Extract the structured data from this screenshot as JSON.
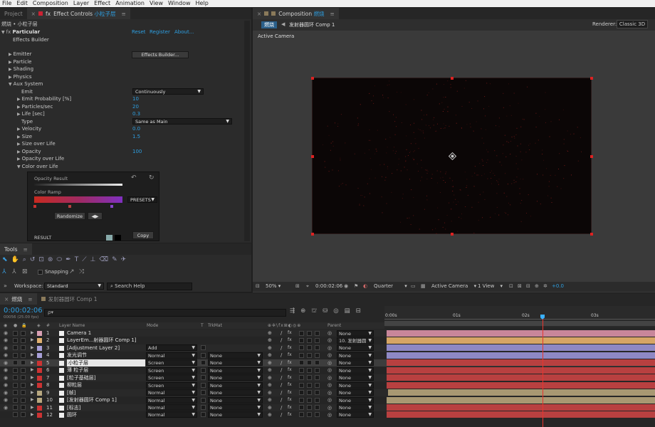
{
  "menubar": [
    "File",
    "Edit",
    "Layer",
    "Effect",
    "Animation",
    "View",
    "Window",
    "Help",
    "Composition"
  ],
  "menu": {
    "file": "File",
    "edit": "Edit",
    "composition": "Composition",
    "layer": "Layer",
    "effect": "Effect",
    "animation": "Animation",
    "view": "View",
    "window": "Window",
    "help": "Help"
  },
  "project_tab": "Project",
  "effect_controls": {
    "tab_label": "Effect Controls",
    "tab_layer": "小粒子层",
    "breadcrumb": "燃烧 • 小粒子层",
    "effect_name": "Particular",
    "reset": "Reset",
    "register": "Register",
    "about": "About...",
    "effects_builder_label": "Effects Builder",
    "effects_builder_button": "Effects Builder...",
    "emitter": "Emitter",
    "particle": "Particle",
    "shading": "Shading",
    "physics": "Physics",
    "aux_system": "Aux System",
    "emit": "Emit",
    "emit_value": "Continuously",
    "emit_probability": "Emit Probability [%]",
    "emit_probability_value": "10",
    "particles_sec": "Particles/sec",
    "particles_sec_value": "20",
    "life_sec": "Life [sec]",
    "life_sec_value": "0.3",
    "type": "Type",
    "type_value": "Same as Main",
    "velocity": "Velocity",
    "velocity_value": "0.0",
    "size": "Size",
    "size_value": "1.5",
    "size_over_life": "Size over Life",
    "opacity": "Opacity",
    "opacity_value": "100",
    "opacity_over_life": "Opacity over Life",
    "color_over_life": "Color over Life",
    "popup": {
      "opacity_result": "Opacity Result",
      "color_ramp": "Color Ramp",
      "presets": "PRESETS",
      "randomize": "Randomize",
      "result": "RESULT",
      "copy": "Copy"
    }
  },
  "tools": {
    "title": "Tools",
    "snapping": "Snapping",
    "workspace_label": "Workspace:",
    "workspace_value": "Standard",
    "search_help": "Search Help"
  },
  "composition": {
    "tab_label": "Composition",
    "tab_name": "燃烧",
    "crumb_active": "燃烧",
    "crumb_next": "发射器圆环 Comp 1",
    "renderer_label": "Renderer:",
    "renderer_value": "Classic 3D",
    "active_camera": "Active Camera",
    "zoom": "50%",
    "timecode": "0:00:02:06",
    "resolution": "Quarter",
    "view": "Active Camera",
    "views": "1 View",
    "exposure": "+0.0"
  },
  "timeline": {
    "tab_active": "燃烧",
    "tab_other": "发射器圆环 Comp 1",
    "timecode": "0:00:02:06",
    "frame_info": "00056 (25.00 fps)",
    "search_placeholder": "ρ▾",
    "col_num": "#",
    "col_layer_name": "Layer Name",
    "col_mode": "Mode",
    "col_t": "T",
    "col_trkmat": "TrkMat",
    "col_parent": "Parent",
    "ruler": [
      "0:00s",
      "01s",
      "02s",
      "03s"
    ],
    "layers": [
      {
        "num": "1",
        "name": "Camera 1",
        "mode": "",
        "trk": "",
        "parent": "None",
        "label_color": "#d9a0b4",
        "bar_color": "#c8869a"
      },
      {
        "num": "2",
        "name": "LayerEm...射器圆环 Comp 1]",
        "mode": "",
        "trk": "",
        "parent": "10. 发射器圆",
        "label_color": "#e0b070",
        "bar_color": "#d6a565"
      },
      {
        "num": "3",
        "name": "[Adjustment Layer 2]",
        "mode": "Add",
        "trk": "",
        "parent": "None",
        "label_color": "#a8a0d8",
        "bar_color": "#8e88c4"
      },
      {
        "num": "4",
        "name": "发光调节",
        "mode": "Normal",
        "trk": "None",
        "parent": "None",
        "label_color": "#a8a0d8",
        "bar_color": "#8e88c4"
      },
      {
        "num": "5",
        "name": "小粒子层",
        "mode": "Screen",
        "trk": "None",
        "parent": "None",
        "label_color": "#cc3333",
        "bar_color": "#b84040"
      },
      {
        "num": "6",
        "name": "薄 粒子层",
        "mode": "Screen",
        "trk": "None",
        "parent": "None",
        "label_color": "#cc3333",
        "bar_color": "#b84040"
      },
      {
        "num": "7",
        "name": "[粒子基础层]",
        "mode": "Screen",
        "trk": "None",
        "parent": "None",
        "label_color": "#cc3333",
        "bar_color": "#b84040"
      },
      {
        "num": "8",
        "name": "柳粒层",
        "mode": "Screen",
        "trk": "None",
        "parent": "None",
        "label_color": "#cc3333",
        "bar_color": "#b84040"
      },
      {
        "num": "9",
        "name": "[帧]",
        "mode": "Normal",
        "trk": "None",
        "parent": "None",
        "label_color": "#b8a880",
        "bar_color": "#a89872"
      },
      {
        "num": "10",
        "name": "[发射器圆环 Comp 1]",
        "mode": "Normal",
        "trk": "None",
        "parent": "None",
        "label_color": "#b8a880",
        "bar_color": "#a89872"
      },
      {
        "num": "11",
        "name": "[标志]",
        "mode": "Normal",
        "trk": "None",
        "parent": "None",
        "label_color": "#cc3333",
        "bar_color": "#b84040"
      },
      {
        "num": "12",
        "name": "圆环",
        "mode": "Normal",
        "trk": "None",
        "parent": "None",
        "label_color": "#cc3333",
        "bar_color": "#b84040"
      }
    ]
  }
}
